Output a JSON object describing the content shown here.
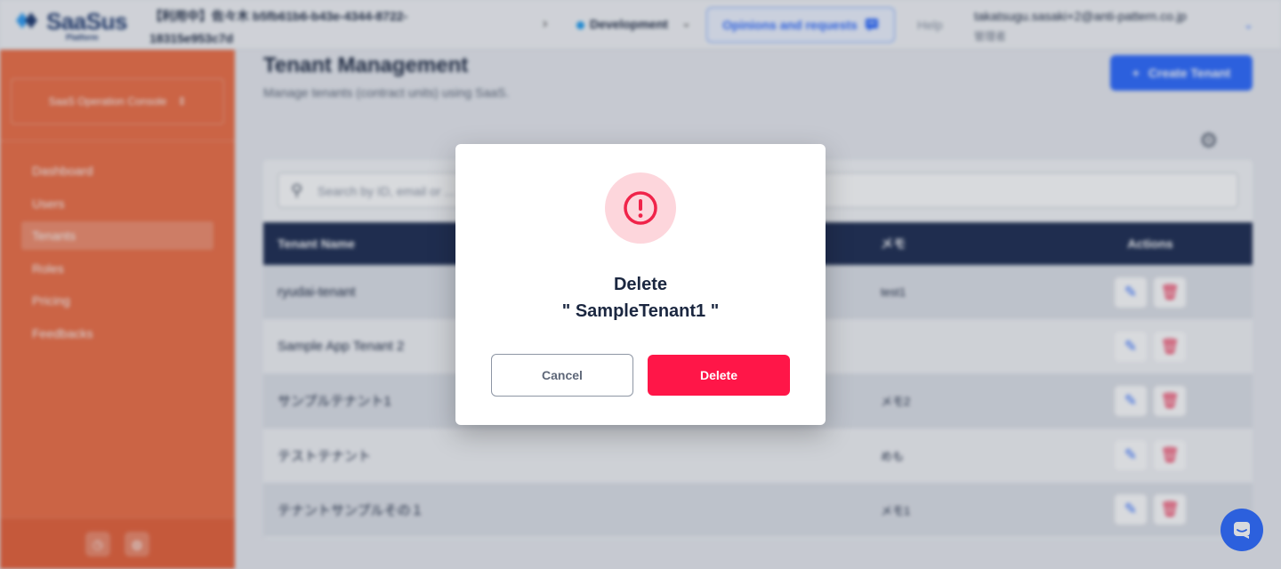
{
  "header": {
    "logo_text": "SaaSus",
    "logo_sub": "Platform",
    "env_id": "【利用中】佐々木 b5fb61b6-b43e-4344-8722-18315e953c7d",
    "env_name": "Development",
    "opinions_label": "Opinions and requests",
    "help_label": "Help",
    "user_email": "takatsugu.sasaki+2@anti-pattern.co.jp",
    "user_role": "管理者"
  },
  "sidebar": {
    "console_label": "SaaS Operation Console",
    "items": [
      {
        "label": "Dashboard"
      },
      {
        "label": "Users"
      },
      {
        "label": "Tenants",
        "active": true
      },
      {
        "label": "Roles"
      },
      {
        "label": "Pricing"
      },
      {
        "label": "Feedbacks"
      }
    ]
  },
  "main": {
    "title": "Tenant Management",
    "subtitle": "Manage tenants (contract units) using SaaS.",
    "create_label": "Create Tenant",
    "search_placeholder": "Search by ID, email or ...",
    "columns": {
      "name": "Tenant Name",
      "memo": "メモ",
      "actions": "Actions"
    },
    "rows": [
      {
        "name": "ryudai-tenant",
        "memo": "test1"
      },
      {
        "name": "Sample App Tenant 2",
        "memo": ""
      },
      {
        "name": "サンプルテナント1",
        "memo": "メモ2"
      },
      {
        "name": "テストテナント",
        "memo": "めも"
      },
      {
        "name": "テナントサンプルその１",
        "memo": "メモ1"
      }
    ]
  },
  "dialog": {
    "title": "Delete",
    "target": "\" SampleTenant1 \"",
    "cancel_label": "Cancel",
    "delete_label": "Delete"
  },
  "colors": {
    "sidebar": "#ef6f46",
    "primary": "#2e6bff",
    "danger": "#ff1648",
    "table_header": "#1e2d52"
  },
  "icons": [
    "chevron-right-icon",
    "chevron-down-icon",
    "feedback-icon",
    "plus-icon",
    "gear-icon",
    "search-icon",
    "edit-icon",
    "trash-icon",
    "alert-icon",
    "chat-icon"
  ]
}
